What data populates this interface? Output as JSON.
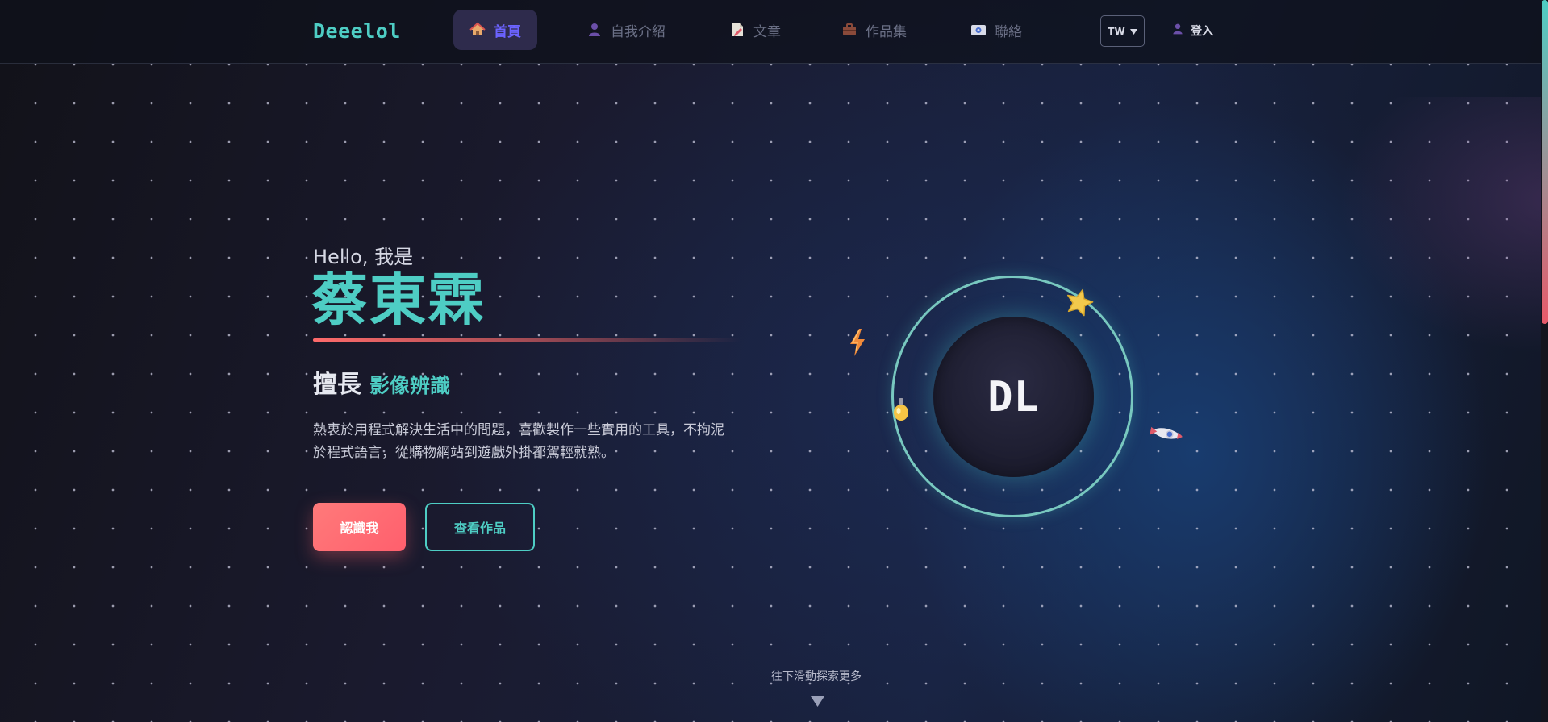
{
  "nav": {
    "logo": "Deeelol",
    "items": [
      {
        "label": "首頁",
        "icon": "house-icon",
        "active": true
      },
      {
        "label": "自我介紹",
        "icon": "person-icon",
        "active": false
      },
      {
        "label": "文章",
        "icon": "document-icon",
        "active": false
      },
      {
        "label": "作品集",
        "icon": "briefcase-icon",
        "active": false
      },
      {
        "label": "聯絡",
        "icon": "id-card-icon",
        "active": false
      }
    ],
    "language": "TW",
    "login": "登入"
  },
  "hero": {
    "greeting": "Hello, 我是",
    "name": "蔡東霖",
    "skill_prefix": "擅長",
    "skill_value": "影像辨識",
    "description": "熱衷於用程式解決生活中的問題，喜歡製作一些實用的工具，不拘泥於程式語言，從購物網站到遊戲外掛都駕輕就熟。",
    "primary_button": "認識我",
    "secondary_button": "查看作品",
    "avatar_text": "DL"
  },
  "scroll_hint": "往下滑動探索更多",
  "colors": {
    "accent": "#4ecdc4",
    "coral": "#ff6b6b",
    "nav_active": "#6c63ff",
    "nav_active_bg": "#2e2b4c"
  }
}
